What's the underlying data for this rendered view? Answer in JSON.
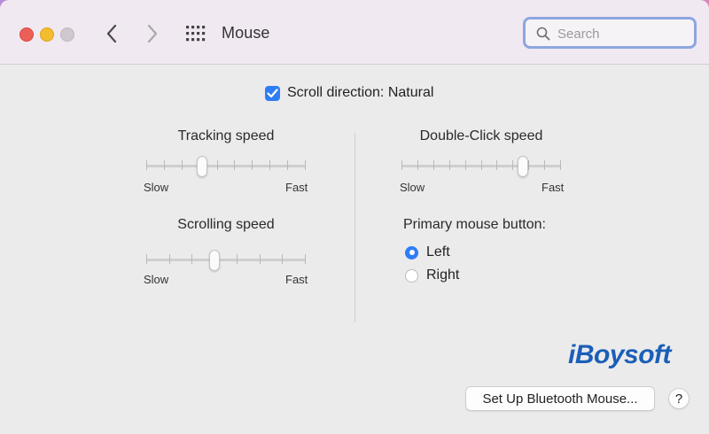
{
  "window": {
    "title": "Mouse"
  },
  "toolbar": {
    "back_icon": "chevron-left-icon",
    "forward_icon": "chevron-right-icon",
    "grid_icon": "grid-icon"
  },
  "search": {
    "placeholder": "Search",
    "value": ""
  },
  "scroll_direction": {
    "label": "Scroll direction: Natural",
    "checked": true
  },
  "tracking_speed": {
    "label": "Tracking speed",
    "slow": "Slow",
    "fast": "Fast",
    "level": 0.34
  },
  "scrolling_speed": {
    "label": "Scrolling speed",
    "slow": "Slow",
    "fast": "Fast",
    "level": 0.42
  },
  "double_click_speed": {
    "label": "Double-Click speed",
    "slow": "Slow",
    "fast": "Fast",
    "level": 0.78
  },
  "primary_button": {
    "label": "Primary mouse button:",
    "options": [
      "Left",
      "Right"
    ],
    "selected": "Left"
  },
  "logo": {
    "text": "iBoysoft"
  },
  "buttons": {
    "setup_bluetooth": "Set Up Bluetooth Mouse...",
    "help": "?"
  },
  "colors": {
    "accent": "#2e7df6",
    "logo": "#1a5fb8",
    "search_focus": "#8ea6df"
  }
}
